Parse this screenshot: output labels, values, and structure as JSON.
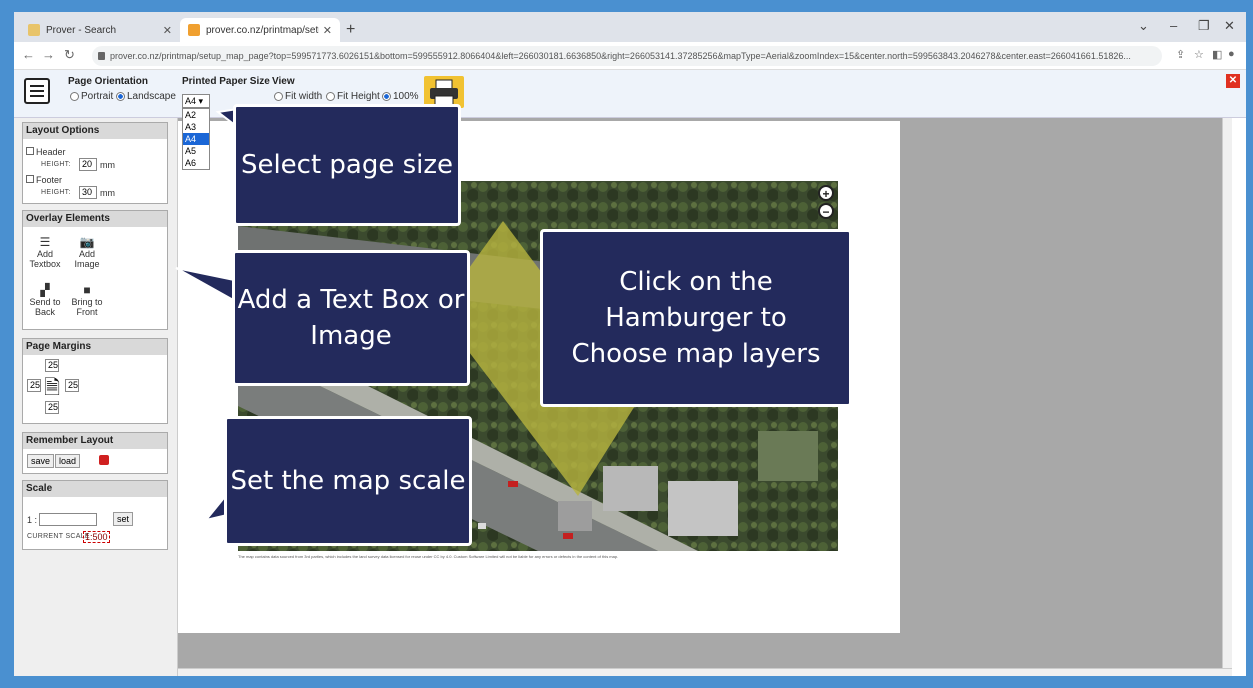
{
  "browser": {
    "tabs": [
      {
        "title": "Prover - Search",
        "active": false
      },
      {
        "title": "prover.co.nz/printmap/setup_m",
        "active": true
      }
    ],
    "url": "prover.co.nz/printmap/setup_map_page?top=599571773.6026151&bottom=599555912.8066404&left=266030181.6636850&right=266053141.37285256&mapType=Aerial&zoomIndex=15&center.north=599563843.2046278&center.east=266041661.51826..."
  },
  "toolbar": {
    "orientation_label": "Page Orientation",
    "portrait": "Portrait",
    "landscape": "Landscape",
    "paper_label": "Printed Paper Size",
    "paper_value": "A4",
    "paper_options": [
      "A2",
      "A3",
      "A4",
      "A5",
      "A6"
    ],
    "view_label": "View",
    "fit_width": "Fit width",
    "fit_height": "Fit Height",
    "zoom_100": "100%"
  },
  "sidebar": {
    "layout": {
      "title": "Layout Options",
      "header": "Header",
      "footer": "Footer",
      "height_label": "HEIGHT:",
      "header_height": "20",
      "footer_height": "30",
      "unit": "mm"
    },
    "overlay": {
      "title": "Overlay Elements",
      "add_textbox": "Add Textbox",
      "add_image": "Add Image",
      "send_back": "Send to Back",
      "bring_front": "Bring to Front"
    },
    "margins": {
      "title": "Page Margins",
      "top": "25",
      "left": "25",
      "right": "25",
      "bottom": "25"
    },
    "remember": {
      "title": "Remember Layout",
      "save": "save",
      "load": "load"
    },
    "scale": {
      "title": "Scale",
      "prefix": "1 :",
      "set": "set",
      "current_label": "CURRENT SCALE",
      "current_value": "1:500"
    }
  },
  "map": {
    "credit": "The map contains data sourced from 3rd parties, which includes the land survey data licensed for reuse under CC by 4.0. Custom Software Limited will not be liable for any errors or defects in the content of this map."
  },
  "callouts": {
    "page_size": "Select page size",
    "text_box": "Add a Text Box or Image",
    "hamburger": "Click on the Hamburger to Choose map layers",
    "scale": "Set the map scale"
  },
  "colors": {
    "callout_bg": "#232a5c",
    "highlight": "#c8c832",
    "accent": "#1a66d6"
  }
}
